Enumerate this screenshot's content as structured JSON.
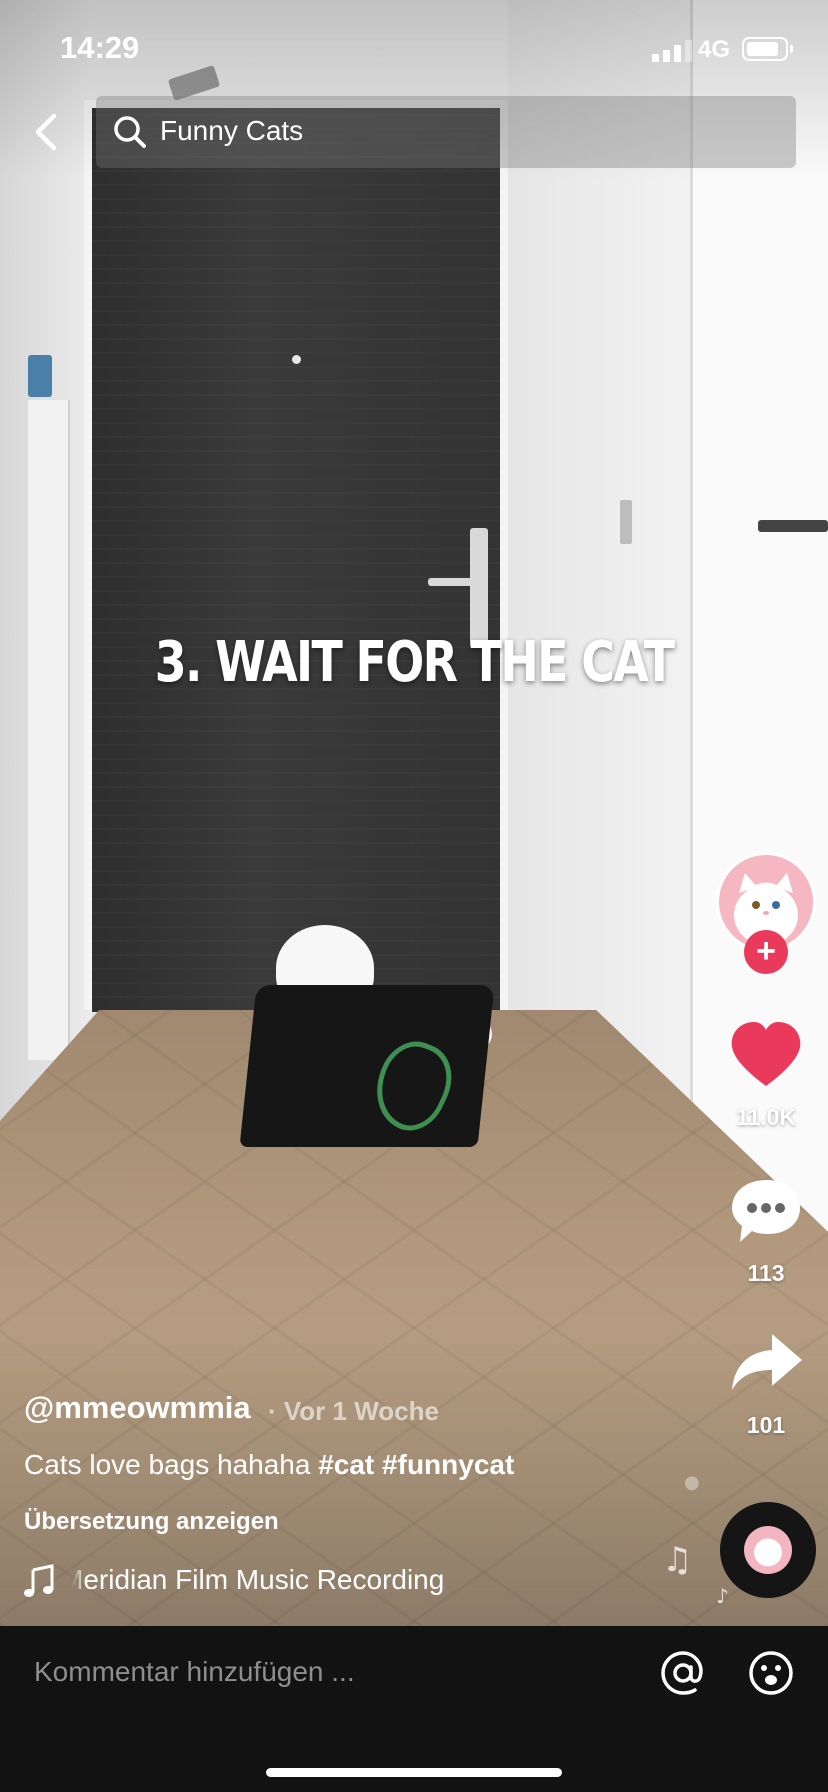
{
  "status_bar": {
    "time": "14:29",
    "network": "4G",
    "signal_bars": 3,
    "battery_level": 0.85
  },
  "header": {
    "back_icon": "chevron-left-icon",
    "search_icon": "search-icon",
    "search_text": "Funny Cats"
  },
  "video": {
    "overlay_text": "3. WAIT FOR THE CAT"
  },
  "actions": {
    "avatar": "cat-avatar",
    "follow_icon": "plus-icon",
    "like_icon": "heart-icon",
    "like_color": "#ea3a5b",
    "like_count": "11.0K",
    "comment_icon": "speech-bubble-icon",
    "comment_count": "113",
    "share_icon": "share-arrow-icon",
    "share_count": "101",
    "sound_disc_icon": "music-disc-icon"
  },
  "post": {
    "username": "@mmeowmmia",
    "time_ago": "· Vor 1 Woche",
    "caption": "Cats love bags hahaha ",
    "hashtags": [
      "#cat",
      "#funnycat"
    ],
    "translate_label": "Übersetzung anzeigen",
    "music_icon": "music-note-icon",
    "music_text": "Meridian Film Music Recording"
  },
  "comment_bar": {
    "placeholder": "Kommentar hinzufügen ...",
    "mention_icon": "at-icon",
    "emoji_icon": "emoji-icon",
    "background_color": "#121212"
  }
}
